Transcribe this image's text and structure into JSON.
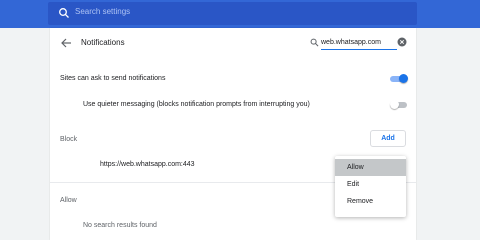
{
  "search": {
    "placeholder": "Search settings"
  },
  "page": {
    "title": "Notifications"
  },
  "filter": {
    "value": "web.whatsapp.com"
  },
  "settings": {
    "sites_can_ask": {
      "label": "Sites can ask to send notifications",
      "enabled": true
    },
    "quieter": {
      "label": "Use quieter messaging (blocks notification prompts from interrupting you)",
      "enabled": false
    }
  },
  "block": {
    "label": "Block",
    "add_label": "Add",
    "sites": [
      "https://web.whatsapp.com:443"
    ]
  },
  "allow": {
    "label": "Allow",
    "empty": "No search results found"
  },
  "menu": {
    "items": [
      "Allow",
      "Edit",
      "Remove"
    ],
    "selected": "Allow"
  },
  "colors": {
    "accent": "#1a73e8",
    "header": "#3367d6"
  }
}
